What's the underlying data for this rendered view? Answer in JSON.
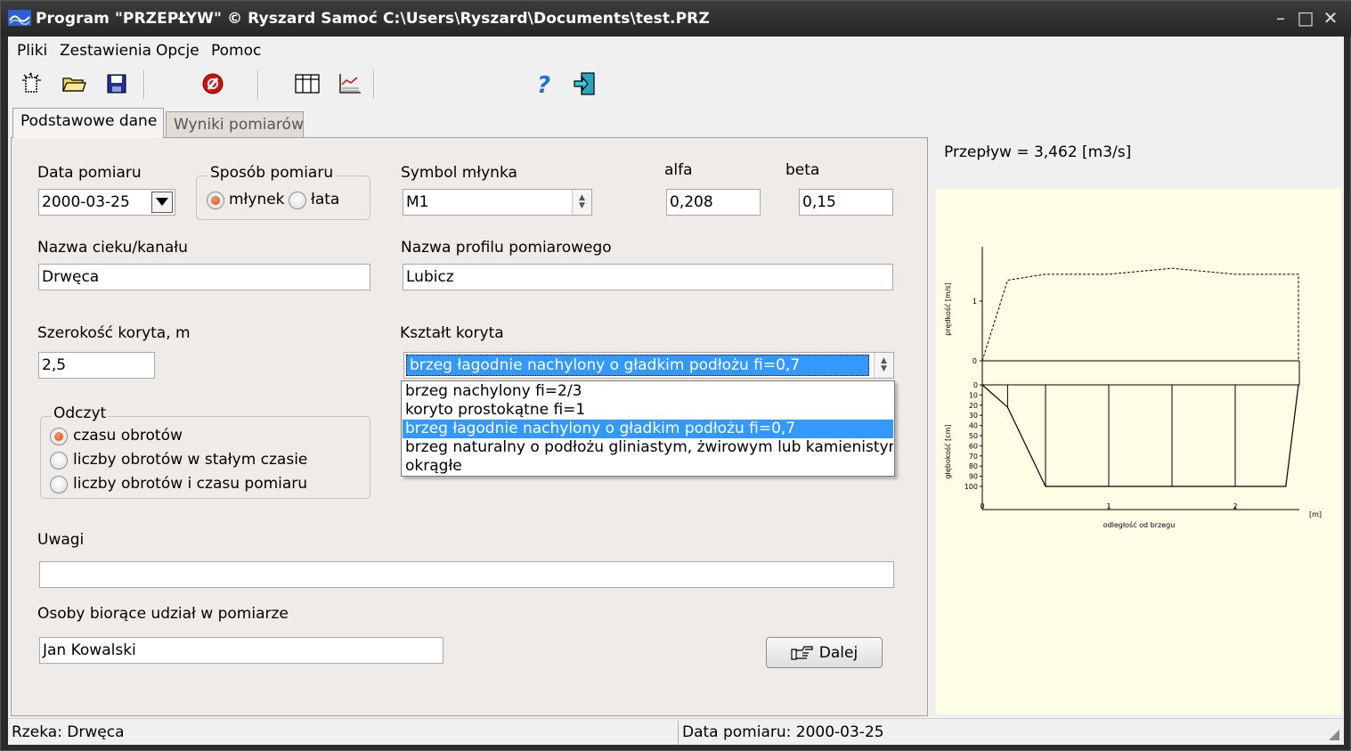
{
  "window": {
    "title": "Program \"PRZEPŁYW\" © Ryszard Samoć  C:\\Users\\Ryszard\\Documents\\test.PRZ",
    "controls": [
      "–",
      "□",
      "✕"
    ]
  },
  "menu": [
    "Pliki",
    "Zestawienia",
    "Opcje",
    "Pomoc"
  ],
  "toolbar": {
    "icons": [
      "new-icon",
      "open-folder-icon",
      "save-icon",
      "stop-icon",
      "table-icon",
      "chart-icon",
      "help-icon",
      "exit-icon"
    ]
  },
  "tabs": [
    {
      "label": "Podstawowe dane",
      "active": true
    },
    {
      "label": "Wyniki pomiarów",
      "active": false
    }
  ],
  "form": {
    "data_pomiaru_label": "Data pomiaru",
    "data_pomiaru_value": "2000-03-25",
    "sposob_label": "Sposób pomiaru",
    "sposob_options": [
      "młynek",
      "łata"
    ],
    "sposob_selected": "młynek",
    "symbol_label": "Symbol młynka",
    "symbol_value": "M1",
    "alfa_label": "alfa",
    "alfa_value": "0,208",
    "beta_label": "beta",
    "beta_value": "0,15",
    "ciek_label": "Nazwa cieku/kanału",
    "ciek_value": "Drwęca",
    "profil_label": "Nazwa profilu pomiarowego",
    "profil_value": "Lubicz",
    "szerokosc_label": "Szerokość koryta, m",
    "szerokosc_value": "2,5",
    "ksztalt_label": "Kształt koryta",
    "ksztalt_value": "brzeg łagodnie nachylony o gładkim podłożu fi=0,7",
    "ksztalt_options": [
      "brzeg nachylony      fi=2/3",
      "koryto prostokątne   fi=1",
      "brzeg łagodnie nachylony o gładkim podłożu fi=0,7",
      "brzeg naturalny o podłożu gliniastym, żwirowym lub kamienistym fi =",
      "okrągłe"
    ],
    "ksztalt_selected_index": 2,
    "odczyt_label": "Odczyt",
    "odczyt_options": [
      "czasu obrotów",
      "liczby obrotów w stałym czasie",
      "liczby obrotów i czasu pomiaru"
    ],
    "odczyt_selected_index": 0,
    "uwagi_label": "Uwagi",
    "uwagi_value": "",
    "osoby_label": "Osoby biorące udział w pomiarze",
    "osoby_value": "Jan Kowalski",
    "dalej_label": "Dalej"
  },
  "result": {
    "przeplyw_text": "Przepływ  = 3,462 [m3/s]"
  },
  "chart_data": {
    "type": "line",
    "velocity": {
      "ylabel": "prędkość [m/s]",
      "yticks": [
        "0",
        "1"
      ],
      "x": [
        0,
        0.2,
        0.5,
        1.0,
        1.5,
        2.0,
        2.5
      ],
      "values": [
        0,
        1.35,
        1.45,
        1.45,
        1.55,
        1.45,
        1.45
      ]
    },
    "depth": {
      "ylabel": "głębokość [cm]",
      "yticks": [
        "0",
        "10",
        "20",
        "30",
        "40",
        "50",
        "60",
        "70",
        "80",
        "90",
        "100"
      ],
      "x": [
        0,
        0.2,
        0.5,
        1.0,
        1.5,
        2.0,
        2.4,
        2.5
      ],
      "values": [
        0,
        22,
        100,
        100,
        100,
        100,
        100,
        0
      ],
      "verticals_x": [
        0.2,
        0.5,
        1.0,
        1.5,
        2.0
      ]
    },
    "xlabel": "odległość od brzegu",
    "xunit": "[m]",
    "xticks": [
      "0",
      "1",
      "2"
    ]
  },
  "status": {
    "left": "Rzeka: Drwęca",
    "right": "Data pomiaru: 2000-03-25"
  }
}
